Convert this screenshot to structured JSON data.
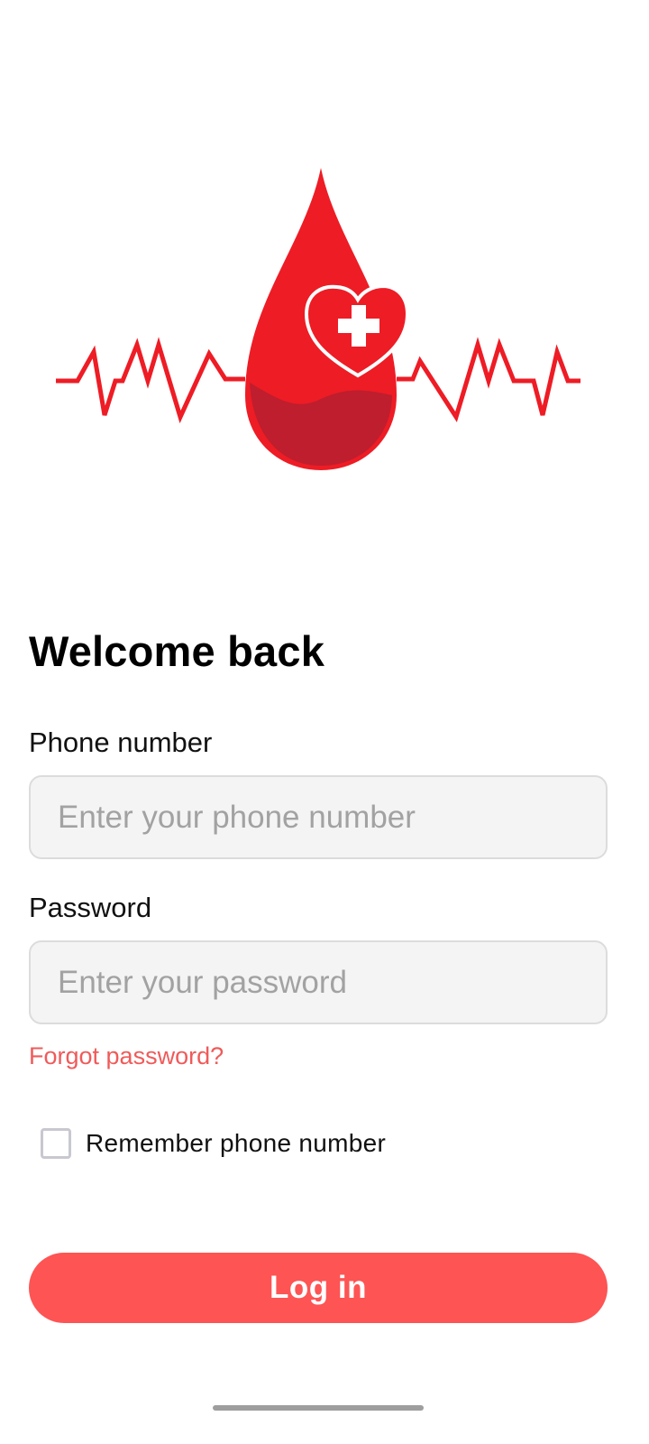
{
  "brand": {
    "logo_icon": "blood-drop-heartbeat-logo",
    "primary_color": "#ee1c25",
    "dark_color": "#be1e2d"
  },
  "login": {
    "title": "Welcome back",
    "phone": {
      "label": "Phone number",
      "placeholder": "Enter your phone number",
      "value": ""
    },
    "password": {
      "label": "Password",
      "placeholder": "Enter your password",
      "value": ""
    },
    "forgot_label": "Forgot password?",
    "remember": {
      "label": "Remember phone number",
      "checked": false
    },
    "submit_label": "Log in",
    "accent_color": "#fe5454"
  }
}
